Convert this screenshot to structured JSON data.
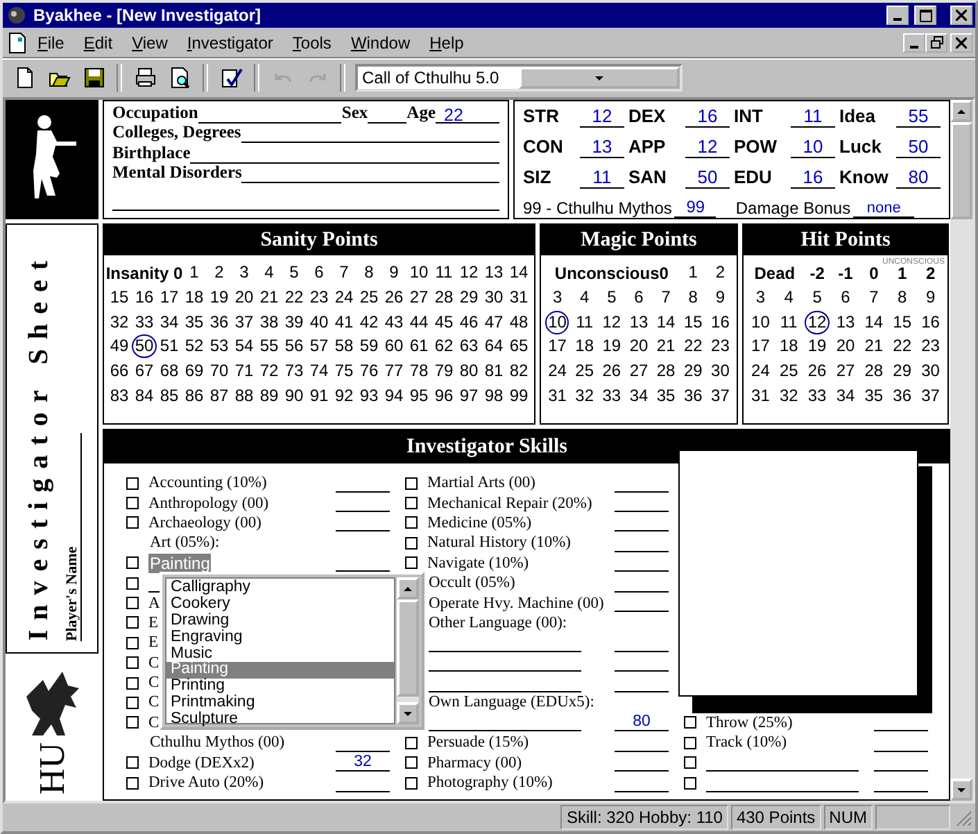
{
  "window": {
    "title": "Byakhee - [New Investigator]"
  },
  "menu": [
    "File",
    "Edit",
    "View",
    "Investigator",
    "Tools",
    "Window",
    "Help"
  ],
  "toolbar": {
    "groups": [
      [
        {
          "disabled": false
        },
        {
          "disabled": false
        },
        {
          "disabled": false
        }
      ],
      [
        {
          "disabled": false
        },
        {
          "disabled": false
        }
      ],
      [
        {
          "disabled": false
        }
      ],
      [
        {
          "disabled": true
        },
        {
          "disabled": true
        }
      ]
    ],
    "ruleset": "Call of Cthulhu 5.0"
  },
  "sidebar": {
    "title": "Investigator Sheet",
    "players_name_label": "Player's Name",
    "logo_text": "HU"
  },
  "personal": {
    "rows": [
      {
        "kind": "fields",
        "fields": [
          {
            "label": "Occupation"
          },
          {
            "label": "Sex"
          },
          {
            "label": "Age",
            "value": "22"
          }
        ]
      },
      {
        "kind": "fields",
        "fields": [
          {
            "label": "Colleges, Degrees"
          }
        ]
      },
      {
        "kind": "fields",
        "fields": [
          {
            "label": "Birthplace"
          }
        ]
      },
      {
        "kind": "fields",
        "fields": [
          {
            "label": "Mental Disorders"
          }
        ]
      },
      {
        "kind": "blank"
      }
    ]
  },
  "stats": {
    "rows": [
      [
        {
          "label": "STR",
          "value": "12"
        },
        {
          "label": "DEX",
          "value": "16"
        },
        {
          "label": "INT",
          "value": "11"
        },
        {
          "label": "Idea",
          "value": "55"
        }
      ],
      [
        {
          "label": "CON",
          "value": "13"
        },
        {
          "label": "APP",
          "value": "12"
        },
        {
          "label": "POW",
          "value": "10"
        },
        {
          "label": "Luck",
          "value": "50"
        }
      ],
      [
        {
          "label": "SIZ",
          "value": "11"
        },
        {
          "label": "SAN",
          "value": "50"
        },
        {
          "label": "EDU",
          "value": "16"
        },
        {
          "label": "Know",
          "value": "80"
        }
      ]
    ],
    "mythos": {
      "label": "99 - Cthulhu Mythos",
      "value": "99"
    },
    "damage_bonus": {
      "label": "Damage Bonus",
      "value": "none"
    }
  },
  "points": [
    {
      "kind": "sanity",
      "title": "Sanity Points",
      "header": [
        "Insanity 0"
      ],
      "numbers": [
        {
          "n": "1",
          "selected": false
        },
        {
          "n": "2",
          "selected": false
        },
        {
          "n": "3",
          "selected": false
        },
        {
          "n": "4",
          "selected": false
        },
        {
          "n": "5",
          "selected": false
        },
        {
          "n": "6",
          "selected": false
        },
        {
          "n": "7",
          "selected": false
        },
        {
          "n": "8",
          "selected": false
        },
        {
          "n": "9",
          "selected": false
        },
        {
          "n": "10",
          "selected": false
        },
        {
          "n": "11",
          "selected": false
        },
        {
          "n": "12",
          "selected": false
        },
        {
          "n": "13",
          "selected": false
        },
        {
          "n": "14",
          "selected": false
        },
        {
          "n": "15",
          "selected": false
        },
        {
          "n": "16",
          "selected": false
        },
        {
          "n": "17",
          "selected": false
        },
        {
          "n": "18",
          "selected": false
        },
        {
          "n": "19",
          "selected": false
        },
        {
          "n": "20",
          "selected": false
        },
        {
          "n": "21",
          "selected": false
        },
        {
          "n": "22",
          "selected": false
        },
        {
          "n": "23",
          "selected": false
        },
        {
          "n": "24",
          "selected": false
        },
        {
          "n": "25",
          "selected": false
        },
        {
          "n": "26",
          "selected": false
        },
        {
          "n": "27",
          "selected": false
        },
        {
          "n": "28",
          "selected": false
        },
        {
          "n": "29",
          "selected": false
        },
        {
          "n": "30",
          "selected": false
        },
        {
          "n": "31",
          "selected": false
        },
        {
          "n": "32",
          "selected": false
        },
        {
          "n": "33",
          "selected": false
        },
        {
          "n": "34",
          "selected": false
        },
        {
          "n": "35",
          "selected": false
        },
        {
          "n": "36",
          "selected": false
        },
        {
          "n": "37",
          "selected": false
        },
        {
          "n": "38",
          "selected": false
        },
        {
          "n": "39",
          "selected": false
        },
        {
          "n": "40",
          "selected": false
        },
        {
          "n": "41",
          "selected": false
        },
        {
          "n": "42",
          "selected": false
        },
        {
          "n": "43",
          "selected": false
        },
        {
          "n": "44",
          "selected": false
        },
        {
          "n": "45",
          "selected": false
        },
        {
          "n": "46",
          "selected": false
        },
        {
          "n": "47",
          "selected": false
        },
        {
          "n": "48",
          "selected": false
        },
        {
          "n": "49",
          "selected": false
        },
        {
          "n": "50",
          "selected": true
        },
        {
          "n": "51",
          "selected": false
        },
        {
          "n": "52",
          "selected": false
        },
        {
          "n": "53",
          "selected": false
        },
        {
          "n": "54",
          "selected": false
        },
        {
          "n": "55",
          "selected": false
        },
        {
          "n": "56",
          "selected": false
        },
        {
          "n": "57",
          "selected": false
        },
        {
          "n": "58",
          "selected": false
        },
        {
          "n": "59",
          "selected": false
        },
        {
          "n": "60",
          "selected": false
        },
        {
          "n": "61",
          "selected": false
        },
        {
          "n": "62",
          "selected": false
        },
        {
          "n": "63",
          "selected": false
        },
        {
          "n": "64",
          "selected": false
        },
        {
          "n": "65",
          "selected": false
        },
        {
          "n": "66",
          "selected": false
        },
        {
          "n": "67",
          "selected": false
        },
        {
          "n": "68",
          "selected": false
        },
        {
          "n": "69",
          "selected": false
        },
        {
          "n": "70",
          "selected": false
        },
        {
          "n": "71",
          "selected": false
        },
        {
          "n": "72",
          "selected": false
        },
        {
          "n": "73",
          "selected": false
        },
        {
          "n": "74",
          "selected": false
        },
        {
          "n": "75",
          "selected": false
        },
        {
          "n": "76",
          "selected": false
        },
        {
          "n": "77",
          "selected": false
        },
        {
          "n": "78",
          "selected": false
        },
        {
          "n": "79",
          "selected": false
        },
        {
          "n": "80",
          "selected": false
        },
        {
          "n": "81",
          "selected": false
        },
        {
          "n": "82",
          "selected": false
        },
        {
          "n": "83",
          "selected": false
        },
        {
          "n": "84",
          "selected": false
        },
        {
          "n": "85",
          "selected": false
        },
        {
          "n": "86",
          "selected": false
        },
        {
          "n": "87",
          "selected": false
        },
        {
          "n": "88",
          "selected": false
        },
        {
          "n": "89",
          "selected": false
        },
        {
          "n": "90",
          "selected": false
        },
        {
          "n": "91",
          "selected": false
        },
        {
          "n": "92",
          "selected": false
        },
        {
          "n": "93",
          "selected": false
        },
        {
          "n": "94",
          "selected": false
        },
        {
          "n": "95",
          "selected": false
        },
        {
          "n": "96",
          "selected": false
        },
        {
          "n": "97",
          "selected": false
        },
        {
          "n": "98",
          "selected": false
        },
        {
          "n": "99",
          "selected": false
        }
      ]
    },
    {
      "kind": "magic",
      "title": "Magic Points",
      "header": [
        "Unconscious0"
      ],
      "numbers": [
        {
          "n": "1",
          "selected": false
        },
        {
          "n": "2",
          "selected": false
        },
        {
          "n": "3",
          "selected": false
        },
        {
          "n": "4",
          "selected": false
        },
        {
          "n": "5",
          "selected": false
        },
        {
          "n": "6",
          "selected": false
        },
        {
          "n": "7",
          "selected": false
        },
        {
          "n": "8",
          "selected": false
        },
        {
          "n": "9",
          "selected": false
        },
        {
          "n": "10",
          "selected": true
        },
        {
          "n": "11",
          "selected": false
        },
        {
          "n": "12",
          "selected": false
        },
        {
          "n": "13",
          "selected": false
        },
        {
          "n": "14",
          "selected": false
        },
        {
          "n": "15",
          "selected": false
        },
        {
          "n": "16",
          "selected": false
        },
        {
          "n": "17",
          "selected": false
        },
        {
          "n": "18",
          "selected": false
        },
        {
          "n": "19",
          "selected": false
        },
        {
          "n": "20",
          "selected": false
        },
        {
          "n": "21",
          "selected": false
        },
        {
          "n": "22",
          "selected": false
        },
        {
          "n": "23",
          "selected": false
        },
        {
          "n": "24",
          "selected": false
        },
        {
          "n": "25",
          "selected": false
        },
        {
          "n": "26",
          "selected": false
        },
        {
          "n": "27",
          "selected": false
        },
        {
          "n": "28",
          "selected": false
        },
        {
          "n": "29",
          "selected": false
        },
        {
          "n": "30",
          "selected": false
        },
        {
          "n": "31",
          "selected": false
        },
        {
          "n": "32",
          "selected": false
        },
        {
          "n": "33",
          "selected": false
        },
        {
          "n": "34",
          "selected": false
        },
        {
          "n": "35",
          "selected": false
        },
        {
          "n": "36",
          "selected": false
        },
        {
          "n": "37",
          "selected": false
        }
      ]
    },
    {
      "kind": "hit",
      "title": "Hit Points",
      "note": "UNCONSCIOUS",
      "header": [
        "Dead",
        "-2",
        "-1",
        "0",
        "1",
        "2"
      ],
      "numbers": [
        {
          "n": "3",
          "selected": false
        },
        {
          "n": "4",
          "selected": false
        },
        {
          "n": "5",
          "selected": false
        },
        {
          "n": "6",
          "selected": false
        },
        {
          "n": "7",
          "selected": false
        },
        {
          "n": "8",
          "selected": false
        },
        {
          "n": "9",
          "selected": false
        },
        {
          "n": "10",
          "selected": false
        },
        {
          "n": "11",
          "selected": false
        },
        {
          "n": "12",
          "selected": true
        },
        {
          "n": "13",
          "selected": false
        },
        {
          "n": "14",
          "selected": false
        },
        {
          "n": "15",
          "selected": false
        },
        {
          "n": "16",
          "selected": false
        },
        {
          "n": "17",
          "selected": false
        },
        {
          "n": "18",
          "selected": false
        },
        {
          "n": "19",
          "selected": false
        },
        {
          "n": "20",
          "selected": false
        },
        {
          "n": "21",
          "selected": false
        },
        {
          "n": "22",
          "selected": false
        },
        {
          "n": "23",
          "selected": false
        },
        {
          "n": "24",
          "selected": false
        },
        {
          "n": "25",
          "selected": false
        },
        {
          "n": "26",
          "selected": false
        },
        {
          "n": "27",
          "selected": false
        },
        {
          "n": "28",
          "selected": false
        },
        {
          "n": "29",
          "selected": false
        },
        {
          "n": "30",
          "selected": false
        },
        {
          "n": "31",
          "selected": false
        },
        {
          "n": "32",
          "selected": false
        },
        {
          "n": "33",
          "selected": false
        },
        {
          "n": "34",
          "selected": false
        },
        {
          "n": "35",
          "selected": false
        },
        {
          "n": "36",
          "selected": false
        },
        {
          "n": "37",
          "selected": false
        }
      ]
    }
  ],
  "skills": {
    "title": "Investigator Skills",
    "columns": [
      {
        "rows": [
          {
            "kind": "skill",
            "label": "Accounting (10%)",
            "checked": false
          },
          {
            "kind": "skill",
            "label": "Anthropology (00)",
            "checked": false
          },
          {
            "kind": "skill",
            "label": "Archaeology (00)",
            "checked": false
          },
          {
            "kind": "heading",
            "label": "Art (05%):"
          },
          {
            "kind": "field",
            "label": "Painting",
            "checked": false,
            "selected": true
          },
          {
            "kind": "stub",
            "checked": false
          },
          {
            "kind": "covered",
            "label": "A",
            "checked": false
          },
          {
            "kind": "covered",
            "label": "E",
            "checked": false
          },
          {
            "kind": "covered",
            "label": "E",
            "checked": false
          },
          {
            "kind": "covered",
            "label": "C",
            "checked": false
          },
          {
            "kind": "covered",
            "label": "C",
            "checked": false
          },
          {
            "kind": "covered",
            "label": "C",
            "checked": false
          },
          {
            "kind": "covered",
            "label": "C",
            "checked": false
          },
          {
            "kind": "plain",
            "label": "Cthulhu Mythos (00)"
          },
          {
            "kind": "skill",
            "label": "Dodge (DEXx2)",
            "checked": false,
            "value": "32"
          },
          {
            "kind": "skill",
            "label": "Drive Auto (20%)",
            "checked": false
          }
        ]
      },
      {
        "rows": [
          {
            "kind": "skill",
            "label": "Martial Arts (00)",
            "checked": false
          },
          {
            "kind": "skill",
            "label": "Mechanical Repair (20%)",
            "checked": false
          },
          {
            "kind": "skill",
            "label": "Medicine (05%)",
            "checked": false
          },
          {
            "kind": "skill",
            "label": "Natural History (10%)",
            "checked": false
          },
          {
            "kind": "skill",
            "label": "Navigate (10%)",
            "checked": false
          },
          {
            "kind": "plain",
            "label": "Occult (05%)"
          },
          {
            "kind": "plain",
            "label": "Operate Hvy. Machine (00)"
          },
          {
            "kind": "heading",
            "label": "Other Language (00):"
          },
          {
            "kind": "line"
          },
          {
            "kind": "line"
          },
          {
            "kind": "line"
          },
          {
            "kind": "heading",
            "label": "Own Language (EDUx5):"
          },
          {
            "kind": "line",
            "value": "80"
          },
          {
            "kind": "skill",
            "label": "Persuade (15%)",
            "checked": false
          },
          {
            "kind": "skill",
            "label": "Pharmacy (00)",
            "checked": false
          },
          {
            "kind": "skill",
            "label": "Photography (10%)",
            "checked": false
          }
        ]
      },
      {
        "rows": [
          {
            "kind": "skill",
            "label": "Throw (25%)",
            "checked": false
          },
          {
            "kind": "skill",
            "label": "Track (10%)",
            "checked": false
          },
          {
            "kind": "blank",
            "checked": false
          },
          {
            "kind": "blank",
            "checked": false
          }
        ]
      }
    ],
    "dropdown": {
      "items": [
        {
          "label": "Calligraphy",
          "selected": false
        },
        {
          "label": "Cookery",
          "selected": false
        },
        {
          "label": "Drawing",
          "selected": false
        },
        {
          "label": "Engraving",
          "selected": false
        },
        {
          "label": "Music",
          "selected": false
        },
        {
          "label": "Painting",
          "selected": true
        },
        {
          "label": "Printing",
          "selected": false
        },
        {
          "label": "Printmaking",
          "selected": false
        },
        {
          "label": "Sculpture",
          "selected": false
        }
      ]
    }
  },
  "status_bar": [
    "Skill: 320 Hobby: 110",
    "430 Points",
    "NUM"
  ]
}
